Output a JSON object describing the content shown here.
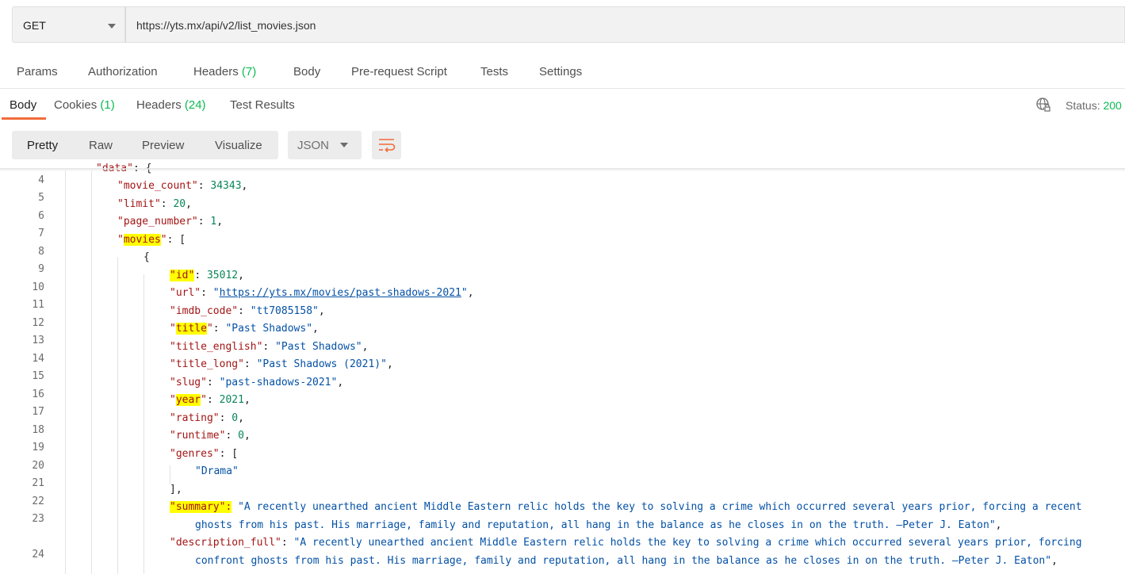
{
  "request": {
    "method": "GET",
    "url": "https://yts.mx/api/v2/list_movies.json"
  },
  "request_tabs": {
    "params": "Params",
    "authorization": "Authorization",
    "headers": "Headers",
    "headers_count": "(7)",
    "body": "Body",
    "prerequest": "Pre-request Script",
    "tests": "Tests",
    "settings": "Settings"
  },
  "response_tabs": {
    "body": "Body",
    "cookies": "Cookies",
    "cookies_count": "(1)",
    "headers": "Headers",
    "headers_count": "(24)",
    "test_results": "Test Results"
  },
  "status": {
    "label": "Status:",
    "value": "200"
  },
  "view_modes": {
    "pretty": "Pretty",
    "raw": "Raw",
    "preview": "Preview",
    "visualize": "Visualize"
  },
  "format": "JSON",
  "colors": {
    "accent": "#f26b3a",
    "count": "#0cbb52",
    "highlight": "#ffff00"
  },
  "code": {
    "l4": {
      "num": "4",
      "key": "\"data\"",
      "rest": ": {"
    },
    "l5": {
      "num": "5",
      "key": "\"movie_count\"",
      "sep": ": ",
      "val": "34343",
      "end": ","
    },
    "l6": {
      "num": "6",
      "key": "\"limit\"",
      "sep": ": ",
      "val": "20",
      "end": ","
    },
    "l7": {
      "num": "7",
      "key": "\"page_number\"",
      "sep": ": ",
      "val": "1",
      "end": ","
    },
    "l8": {
      "num": "8",
      "q1": "\"",
      "key": "movies",
      "q2": "\"",
      "rest": ": ["
    },
    "l9": {
      "num": "9",
      "text": "{"
    },
    "l10": {
      "num": "10",
      "key": "\"id\"",
      "sep": ": ",
      "val": "35012",
      "end": ","
    },
    "l11": {
      "num": "11",
      "key": "\"url\"",
      "sep": ": ",
      "q1": "\"",
      "val": "https://yts.mx/movies/past-shadows-2021",
      "q2": "\"",
      "end": ","
    },
    "l12": {
      "num": "12",
      "key": "\"imdb_code\"",
      "sep": ": ",
      "val": "\"tt7085158\"",
      "end": ","
    },
    "l13": {
      "num": "13",
      "q1": "\"",
      "key": "title",
      "q2": "\"",
      "sep": ": ",
      "val": "\"Past Shadows\"",
      "end": ","
    },
    "l14": {
      "num": "14",
      "key": "\"title_english\"",
      "sep": ": ",
      "val": "\"Past Shadows\"",
      "end": ","
    },
    "l15": {
      "num": "15",
      "key": "\"title_long\"",
      "sep": ": ",
      "val": "\"Past Shadows (2021)\"",
      "end": ","
    },
    "l16": {
      "num": "16",
      "key": "\"slug\"",
      "sep": ": ",
      "val": "\"past-shadows-2021\"",
      "end": ","
    },
    "l17": {
      "num": "17",
      "q1": "\"",
      "key": "year",
      "q2": "\"",
      "sep": ": ",
      "val": "2021",
      "end": ","
    },
    "l18": {
      "num": "18",
      "key": "\"rating\"",
      "sep": ": ",
      "val": "0",
      "end": ","
    },
    "l19": {
      "num": "19",
      "key": "\"runtime\"",
      "sep": ": ",
      "val": "0",
      "end": ","
    },
    "l20": {
      "num": "20",
      "key": "\"genres\"",
      "rest": ": ["
    },
    "l21": {
      "num": "21",
      "val": "\"Drama\""
    },
    "l22": {
      "num": "22",
      "text": "],"
    },
    "l23": {
      "num": "23",
      "key": "\"summary\":",
      "sep": " ",
      "val": "\"A recently unearthed ancient Middle Eastern relic holds the key to solving a crime which occurred several years prior, forcing a recent",
      "cont": "ghosts from his past. His marriage, family and reputation, all hang in the balance as he closes in on the truth. —Peter J. Eaton\"",
      "cont_end": ","
    },
    "l24": {
      "num": "24",
      "key": "\"description_full\"",
      "sep": ": ",
      "val": "\"A recently unearthed ancient Middle Eastern relic holds the key to solving a crime which occurred several years prior, forcing",
      "cont": "confront ghosts from his past. His marriage, family and reputation, all hang in the balance as he closes in on the truth. —Peter J. Eaton\"",
      "cont_end": ","
    }
  }
}
